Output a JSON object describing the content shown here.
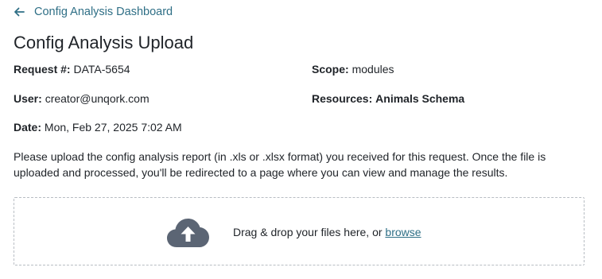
{
  "nav": {
    "back_label": "Config Analysis Dashboard"
  },
  "page": {
    "title": "Config Analysis Upload"
  },
  "meta": {
    "request_label": "Request #:",
    "request_value": "DATA-5654",
    "scope_label": "Scope:",
    "scope_value": "modules",
    "user_label": "User:",
    "user_value": "creator@unqork.com",
    "resources_label": "Resources:",
    "resources_value": "Animals Schema",
    "date_label": "Date:",
    "date_value": "Mon, Feb 27, 2025 7:02 AM"
  },
  "description": "Please upload the config analysis report (in .xls or .xlsx format) you received for this request. Once the file is uploaded and processed, you'll be redirected to a page where you can view and manage the results.",
  "upload": {
    "prompt": "Drag & drop your files here, or",
    "browse_label": "browse",
    "icon": "cloud-upload-icon"
  },
  "colors": {
    "accent": "#2f6f86",
    "icon": "#5b6574",
    "border": "#b8bdc3"
  }
}
